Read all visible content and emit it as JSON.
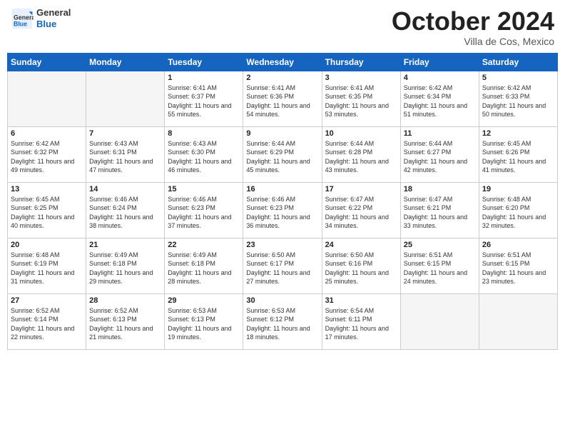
{
  "header": {
    "logo_line1": "General",
    "logo_line2": "Blue",
    "month": "October 2024",
    "location": "Villa de Cos, Mexico"
  },
  "weekdays": [
    "Sunday",
    "Monday",
    "Tuesday",
    "Wednesday",
    "Thursday",
    "Friday",
    "Saturday"
  ],
  "weeks": [
    [
      {
        "day": "",
        "sunrise": "",
        "sunset": "",
        "daylight": "",
        "empty": true
      },
      {
        "day": "",
        "sunrise": "",
        "sunset": "",
        "daylight": "",
        "empty": true
      },
      {
        "day": "1",
        "sunrise": "Sunrise: 6:41 AM",
        "sunset": "Sunset: 6:37 PM",
        "daylight": "Daylight: 11 hours and 55 minutes."
      },
      {
        "day": "2",
        "sunrise": "Sunrise: 6:41 AM",
        "sunset": "Sunset: 6:36 PM",
        "daylight": "Daylight: 11 hours and 54 minutes."
      },
      {
        "day": "3",
        "sunrise": "Sunrise: 6:41 AM",
        "sunset": "Sunset: 6:35 PM",
        "daylight": "Daylight: 11 hours and 53 minutes."
      },
      {
        "day": "4",
        "sunrise": "Sunrise: 6:42 AM",
        "sunset": "Sunset: 6:34 PM",
        "daylight": "Daylight: 11 hours and 51 minutes."
      },
      {
        "day": "5",
        "sunrise": "Sunrise: 6:42 AM",
        "sunset": "Sunset: 6:33 PM",
        "daylight": "Daylight: 11 hours and 50 minutes."
      }
    ],
    [
      {
        "day": "6",
        "sunrise": "Sunrise: 6:42 AM",
        "sunset": "Sunset: 6:32 PM",
        "daylight": "Daylight: 11 hours and 49 minutes."
      },
      {
        "day": "7",
        "sunrise": "Sunrise: 6:43 AM",
        "sunset": "Sunset: 6:31 PM",
        "daylight": "Daylight: 11 hours and 47 minutes."
      },
      {
        "day": "8",
        "sunrise": "Sunrise: 6:43 AM",
        "sunset": "Sunset: 6:30 PM",
        "daylight": "Daylight: 11 hours and 46 minutes."
      },
      {
        "day": "9",
        "sunrise": "Sunrise: 6:44 AM",
        "sunset": "Sunset: 6:29 PM",
        "daylight": "Daylight: 11 hours and 45 minutes."
      },
      {
        "day": "10",
        "sunrise": "Sunrise: 6:44 AM",
        "sunset": "Sunset: 6:28 PM",
        "daylight": "Daylight: 11 hours and 43 minutes."
      },
      {
        "day": "11",
        "sunrise": "Sunrise: 6:44 AM",
        "sunset": "Sunset: 6:27 PM",
        "daylight": "Daylight: 11 hours and 42 minutes."
      },
      {
        "day": "12",
        "sunrise": "Sunrise: 6:45 AM",
        "sunset": "Sunset: 6:26 PM",
        "daylight": "Daylight: 11 hours and 41 minutes."
      }
    ],
    [
      {
        "day": "13",
        "sunrise": "Sunrise: 6:45 AM",
        "sunset": "Sunset: 6:25 PM",
        "daylight": "Daylight: 11 hours and 40 minutes."
      },
      {
        "day": "14",
        "sunrise": "Sunrise: 6:46 AM",
        "sunset": "Sunset: 6:24 PM",
        "daylight": "Daylight: 11 hours and 38 minutes."
      },
      {
        "day": "15",
        "sunrise": "Sunrise: 6:46 AM",
        "sunset": "Sunset: 6:23 PM",
        "daylight": "Daylight: 11 hours and 37 minutes."
      },
      {
        "day": "16",
        "sunrise": "Sunrise: 6:46 AM",
        "sunset": "Sunset: 6:23 PM",
        "daylight": "Daylight: 11 hours and 36 minutes."
      },
      {
        "day": "17",
        "sunrise": "Sunrise: 6:47 AM",
        "sunset": "Sunset: 6:22 PM",
        "daylight": "Daylight: 11 hours and 34 minutes."
      },
      {
        "day": "18",
        "sunrise": "Sunrise: 6:47 AM",
        "sunset": "Sunset: 6:21 PM",
        "daylight": "Daylight: 11 hours and 33 minutes."
      },
      {
        "day": "19",
        "sunrise": "Sunrise: 6:48 AM",
        "sunset": "Sunset: 6:20 PM",
        "daylight": "Daylight: 11 hours and 32 minutes."
      }
    ],
    [
      {
        "day": "20",
        "sunrise": "Sunrise: 6:48 AM",
        "sunset": "Sunset: 6:19 PM",
        "daylight": "Daylight: 11 hours and 31 minutes."
      },
      {
        "day": "21",
        "sunrise": "Sunrise: 6:49 AM",
        "sunset": "Sunset: 6:18 PM",
        "daylight": "Daylight: 11 hours and 29 minutes."
      },
      {
        "day": "22",
        "sunrise": "Sunrise: 6:49 AM",
        "sunset": "Sunset: 6:18 PM",
        "daylight": "Daylight: 11 hours and 28 minutes."
      },
      {
        "day": "23",
        "sunrise": "Sunrise: 6:50 AM",
        "sunset": "Sunset: 6:17 PM",
        "daylight": "Daylight: 11 hours and 27 minutes."
      },
      {
        "day": "24",
        "sunrise": "Sunrise: 6:50 AM",
        "sunset": "Sunset: 6:16 PM",
        "daylight": "Daylight: 11 hours and 25 minutes."
      },
      {
        "day": "25",
        "sunrise": "Sunrise: 6:51 AM",
        "sunset": "Sunset: 6:15 PM",
        "daylight": "Daylight: 11 hours and 24 minutes."
      },
      {
        "day": "26",
        "sunrise": "Sunrise: 6:51 AM",
        "sunset": "Sunset: 6:15 PM",
        "daylight": "Daylight: 11 hours and 23 minutes."
      }
    ],
    [
      {
        "day": "27",
        "sunrise": "Sunrise: 6:52 AM",
        "sunset": "Sunset: 6:14 PM",
        "daylight": "Daylight: 11 hours and 22 minutes."
      },
      {
        "day": "28",
        "sunrise": "Sunrise: 6:52 AM",
        "sunset": "Sunset: 6:13 PM",
        "daylight": "Daylight: 11 hours and 21 minutes."
      },
      {
        "day": "29",
        "sunrise": "Sunrise: 6:53 AM",
        "sunset": "Sunset: 6:13 PM",
        "daylight": "Daylight: 11 hours and 19 minutes."
      },
      {
        "day": "30",
        "sunrise": "Sunrise: 6:53 AM",
        "sunset": "Sunset: 6:12 PM",
        "daylight": "Daylight: 11 hours and 18 minutes."
      },
      {
        "day": "31",
        "sunrise": "Sunrise: 6:54 AM",
        "sunset": "Sunset: 6:11 PM",
        "daylight": "Daylight: 11 hours and 17 minutes."
      },
      {
        "day": "",
        "sunrise": "",
        "sunset": "",
        "daylight": "",
        "empty": true
      },
      {
        "day": "",
        "sunrise": "",
        "sunset": "",
        "daylight": "",
        "empty": true
      }
    ]
  ]
}
